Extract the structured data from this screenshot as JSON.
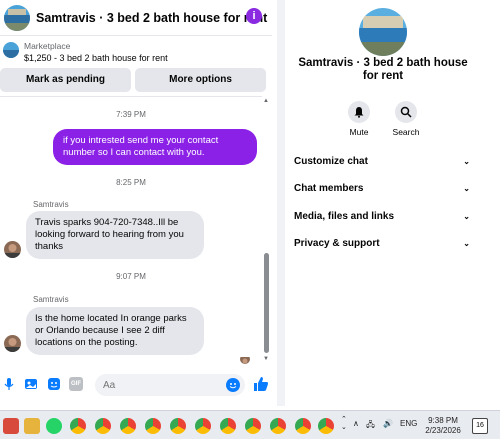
{
  "chat": {
    "title": "Samtravis · 3 bed 2 bath house for rent",
    "info_icon": "i",
    "listing": {
      "source": "Marketplace",
      "price_line": "$1,250 - 3 bed 2 bath house for rent"
    },
    "buttons": {
      "mark_pending": "Mark as pending",
      "more_options": "More options"
    },
    "messages": [
      {
        "timestamp": "7:39 PM",
        "direction": "outgoing",
        "text": "if you intrested send me your contact number  so I can contact with you."
      },
      {
        "timestamp": "8:25 PM",
        "direction": "incoming",
        "sender": "Samtravis",
        "text": "Travis sparks 904-720-7348..Ill be looking forward to hearing from you thanks"
      },
      {
        "timestamp": "9:07 PM",
        "direction": "incoming",
        "sender": "Samtravis",
        "text": "Is the home located In orange parks or Orlando because I see 2 diff locations on the posting."
      }
    ],
    "composer": {
      "placeholder": "Aa",
      "gif_label": "GIF"
    }
  },
  "side": {
    "name": "Samtravis · 3 bed 2 bath house for rent",
    "actions": [
      {
        "label": "Mute",
        "icon": "bell-icon"
      },
      {
        "label": "Search",
        "icon": "search-icon"
      }
    ],
    "menu": [
      {
        "label": "Customize chat"
      },
      {
        "label": "Chat members"
      },
      {
        "label": "Media, files and links"
      },
      {
        "label": "Privacy & support"
      }
    ]
  },
  "taskbar": {
    "language": "ENG",
    "time": "9:38 PM",
    "date": "2/23/2026",
    "notifications": "16"
  },
  "colors": {
    "accent": "#8b20e6",
    "messenger_blue": "#0a7cff",
    "bubble_gray": "#e4e6eb"
  }
}
